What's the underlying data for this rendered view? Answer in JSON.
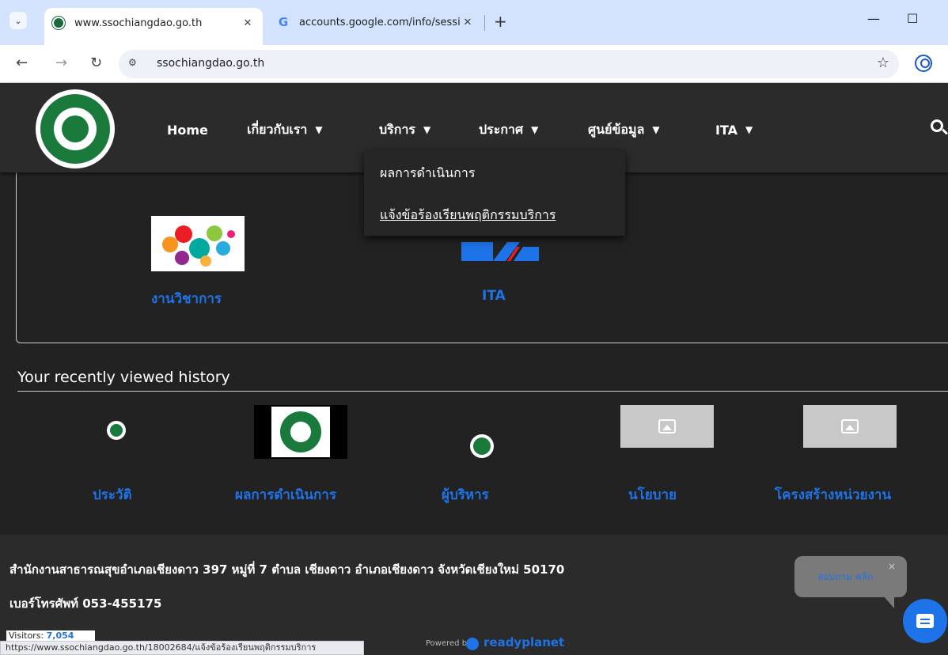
{
  "browser": {
    "tabs": [
      {
        "title": "www.ssochiangdao.go.th",
        "active": true
      },
      {
        "title": "accounts.google.com/info/sessi",
        "active": false
      }
    ],
    "url": "ssochiangdao.go.th",
    "status_url": "https://www.ssochiangdao.go.th/18002684/แจ้งข้อร้องเรียนพฤติกรรมบริการ"
  },
  "nav": {
    "items": [
      {
        "label": "Home",
        "has_caret": false
      },
      {
        "label": "เกี่ยวกับเรา",
        "has_caret": true
      },
      {
        "label": "บริการ",
        "has_caret": true
      },
      {
        "label": "ประกาศ",
        "has_caret": true
      },
      {
        "label": "ศูนย์ข้อมูล",
        "has_caret": true
      },
      {
        "label": "ITA",
        "has_caret": true
      }
    ],
    "dropdown": [
      "ผลการดำเนินการ",
      "แจ้งข้อร้องเรียนพฤติกรรมบริการ"
    ]
  },
  "card": {
    "items": [
      {
        "label": "งานวิชาการ",
        "icon": "academic-collage-image"
      },
      {
        "label": "ITA",
        "icon": "ita-logo"
      }
    ]
  },
  "history": {
    "title": "Your recently viewed history",
    "items": [
      {
        "label": "ประวัติ",
        "image": "moph-emblem"
      },
      {
        "label": "ผลการดำเนินการ",
        "image": "moph-logo-photo"
      },
      {
        "label": "ผู้บริหาร",
        "image": "moph-emblem"
      },
      {
        "label": "นโยบาย",
        "image": "image-placeholder"
      },
      {
        "label": "โครงสร้างหน่วยงาน",
        "image": "image-placeholder"
      }
    ]
  },
  "footer": {
    "address": "สำนักงานสาธารณสุขอำเภอเชียงดาว 397 หมู่ที่ 7 ตำบล เชียงดาว อำเภอเชียงดาว จังหวัดเชียงใหม่ 50170",
    "phone": "เบอร์โทรศัพท์ 053-455175",
    "visitors_label": "Visitors:",
    "visitors_count": "7,054",
    "powered_by": "Powered by",
    "brand": "readyplanet"
  },
  "chat": {
    "prompt": "สอบถาม คลิก",
    "close": "×"
  },
  "colors": {
    "accent_blue": "#1e73e8",
    "moph_green": "#1a7a3c",
    "header_bg": "#2b2b2b"
  }
}
